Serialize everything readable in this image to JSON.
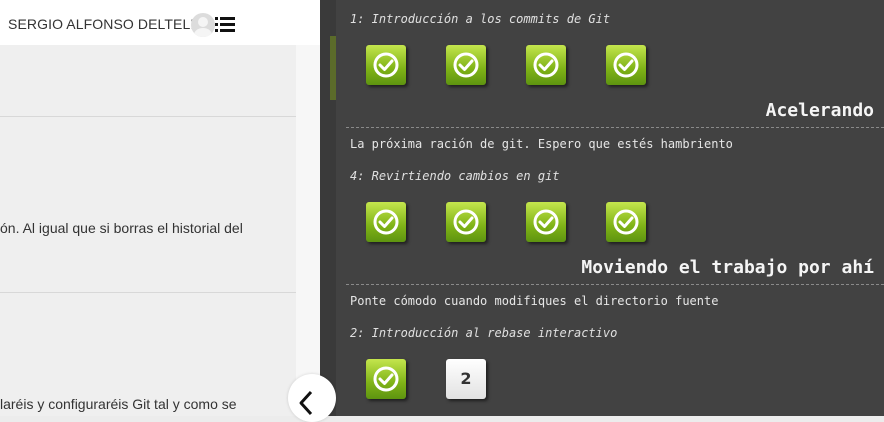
{
  "header": {
    "user_name": "SERGIO ALFONSO DELTELL"
  },
  "icons": {
    "avatar": "avatar-icon",
    "menu": "list-menu-icon",
    "back": "chevron-left-icon",
    "check": "check-circle-icon"
  },
  "colors": {
    "panel_bg": "#424242",
    "badge_done": "#7fb317",
    "badge_todo": "#e8e8e8"
  },
  "article": {
    "snippets": [
      "ón. Al igual que si borras el historial del",
      "laréis y configuraréis Git tal y como se"
    ]
  },
  "levels_panel": {
    "group1": {
      "level_title": "1: Introducción a los commits de Git",
      "badges": [
        "",
        "",
        "",
        ""
      ]
    },
    "section2": {
      "title": "Acelerando",
      "description": "La próxima ración de git. Espero que estés hambriento",
      "level_title": "4: Revirtiendo cambios en git",
      "badges": [
        "",
        "",
        "",
        ""
      ]
    },
    "section3": {
      "title": "Moviendo el trabajo por ahí",
      "description": "Ponte cómodo cuando modifiques el directorio fuente",
      "level_title": "2: Introducción al rebase interactivo",
      "badges": [
        "",
        "2"
      ]
    }
  }
}
